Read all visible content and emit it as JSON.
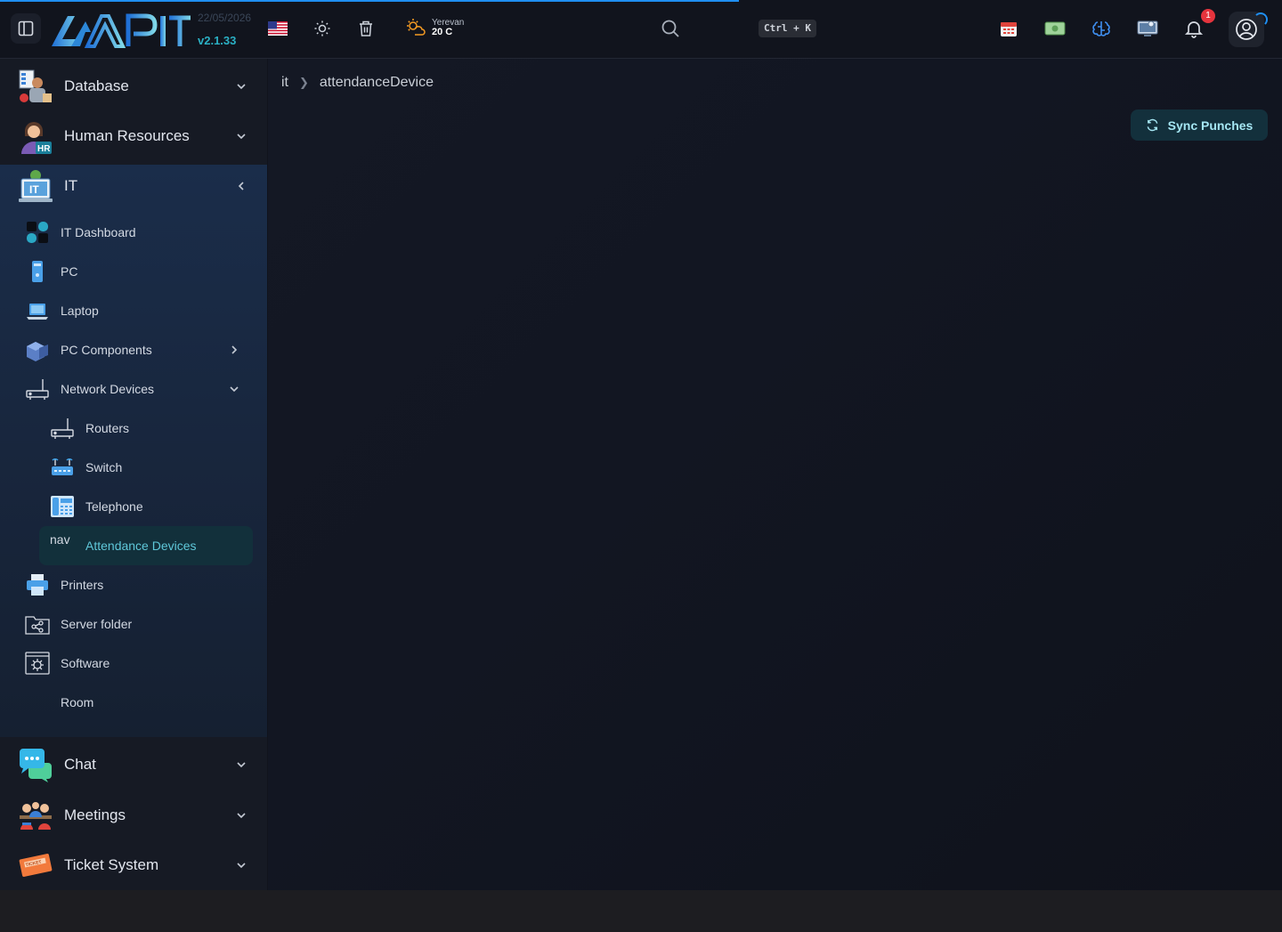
{
  "header": {
    "date": "22/05/2026",
    "version": "v2.1.33",
    "weather": {
      "city": "Yerevan",
      "temp": "20 C"
    },
    "shortcut": "Ctrl + K",
    "notification_count": "1"
  },
  "sidebar": {
    "sections": [
      {
        "label": "Database"
      },
      {
        "label": "Human Resources"
      },
      {
        "label": "IT"
      },
      {
        "label": "Chat"
      },
      {
        "label": "Meetings"
      },
      {
        "label": "Ticket System"
      }
    ],
    "it_items": [
      {
        "label": "IT Dashboard"
      },
      {
        "label": "PC"
      },
      {
        "label": "Laptop"
      },
      {
        "label": "PC Components"
      },
      {
        "label": "Network Devices"
      },
      {
        "label": "Routers"
      },
      {
        "label": "Switch"
      },
      {
        "label": "Telephone"
      },
      {
        "label": "Attendance Devices",
        "broken_alt": "nav"
      },
      {
        "label": "Printers"
      },
      {
        "label": "Server folder"
      },
      {
        "label": "Software"
      },
      {
        "label": "Room"
      }
    ]
  },
  "main": {
    "breadcrumb": [
      "it",
      "attendanceDevice"
    ],
    "sync_button": "Sync Punches"
  }
}
